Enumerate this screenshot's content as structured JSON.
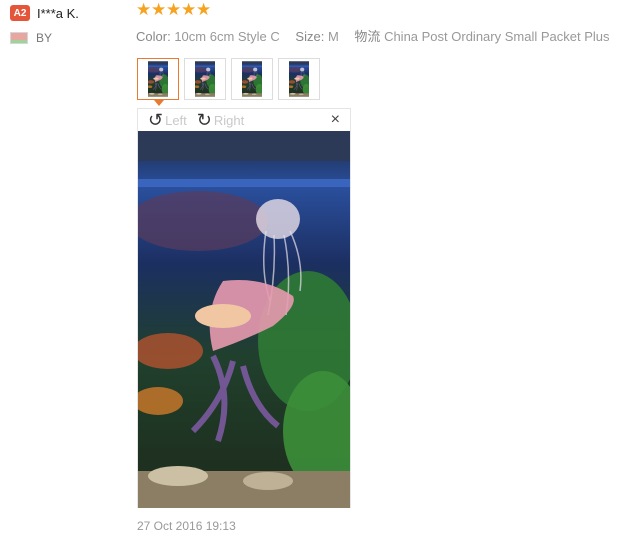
{
  "reviewer": {
    "badge": "A2",
    "name": "I***a K.",
    "country": "BY"
  },
  "rating": {
    "stars": 5,
    "color": "#f6a321"
  },
  "meta": {
    "color_label": "Color:",
    "color_value": "10cm 6cm Style C",
    "size_label": "Size:",
    "size_value": "M",
    "shipping_label": "物流",
    "shipping_value": "China Post Ordinary Small Packet Plus"
  },
  "thumbnails": [
    {
      "active": true
    },
    {
      "active": false
    },
    {
      "active": false
    },
    {
      "active": false
    }
  ],
  "viewer": {
    "rotate_left_label": "Left",
    "rotate_right_label": "Right",
    "close_glyph": "×"
  },
  "timestamp": "27 Oct 2016 19:13",
  "colors": {
    "badge": "#e4553a",
    "active_thumb_border": "#e87a32"
  }
}
